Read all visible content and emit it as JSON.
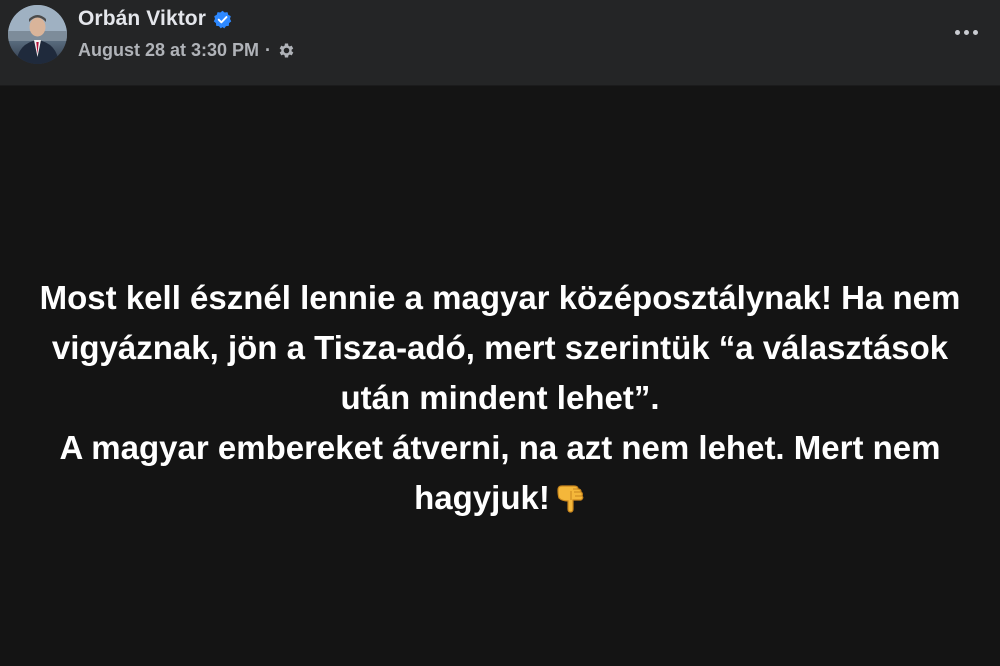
{
  "author": {
    "name": "Orbán Viktor",
    "verified": true,
    "verified_icon": "verified-badge-icon",
    "verified_color": "#2d88ff"
  },
  "meta": {
    "timestamp": "August 28 at 3:30 PM",
    "separator": "·",
    "audience_icon": "gear-icon"
  },
  "actions": {
    "more_icon": "more-horizontal-icon"
  },
  "post": {
    "paragraphs": [
      "Most kell észnél lennie a magyar középosztálynak! Ha nem vigyáznak, jön a Tisza-adó, mert szerintük “a választások után mindent lehet”.",
      "A magyar embereket átverni, na azt nem lehet. Mert nem hagyjuk!"
    ],
    "trailing_emoji": "pointing-down-hand-icon",
    "background_color": "#141414",
    "text_color": "#ffffff"
  }
}
